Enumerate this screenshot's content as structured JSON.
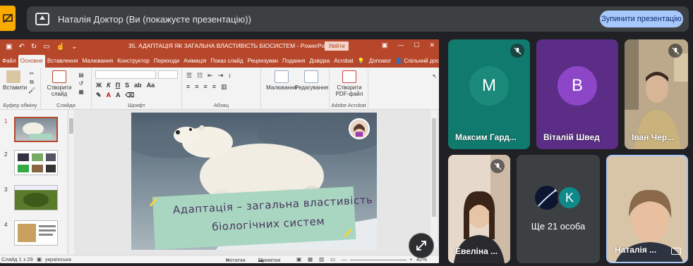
{
  "presenting": {
    "text": "Наталія Доктор (Ви (покажуєте презентацію))",
    "stop_button": "Зупинити презентацію"
  },
  "ppt": {
    "window_title": "35. АДАПТАЦІЯ ЯК ЗАГАЛЬНА ВЛАСТИВІСТЬ БІОСИСТЕМ  -  PowerPoint",
    "sign_in": "Увійти",
    "tabs": [
      "Файл",
      "Основне",
      "Вставлення",
      "Малювання",
      "Конструктор",
      "Переходи",
      "Анімація",
      "Показ слайд",
      "Рецензуван",
      "Подання",
      "Довідка",
      "Acrobat"
    ],
    "active_tab": "Основне",
    "help_label": "Допомог",
    "share_label": "Спільний доступ",
    "ribbon": {
      "paste": "Вставити",
      "new_slide": "Створити слайд",
      "drawing": "Малювання",
      "editing": "Редагування",
      "create_pdf": "Створити PDF-файл",
      "groups": {
        "clipboard": "Буфер обміну",
        "slides": "Слайди",
        "font": "Шрифт",
        "paragraph": "Абзац",
        "acrobat": "Adobe Acrobat"
      }
    },
    "thumb_numbers": [
      "1",
      "2",
      "3",
      "4"
    ],
    "slide": {
      "line1": "Адаптація – загальна властивість",
      "line2": "біологічних систем"
    },
    "status": {
      "slide_info": "Слайд 1 з 29",
      "language": "українська",
      "notes": "Нотатки",
      "comments": "Примітки",
      "zoom": "42%"
    }
  },
  "participants": [
    {
      "name": "Максим Гард...",
      "initial": "M",
      "color": "#0f7a6d",
      "avatar_bg": "#1b8a7a"
    },
    {
      "name": "Віталій Швед",
      "initial": "В",
      "color": "#5b2d86",
      "avatar_bg": "#8c46c7"
    },
    {
      "name": "Іван Чер..."
    },
    {
      "name": "Евеліна ..."
    },
    {
      "name": "Ще 21 особа",
      "initial": "K",
      "avatar_bg": "#0f8a8a"
    },
    {
      "name": "Наталія ..."
    }
  ],
  "colors": {
    "ppt_accent": "#b7472a",
    "stop_button": "#a8c7fa",
    "present_badge": "#f9ab00"
  }
}
